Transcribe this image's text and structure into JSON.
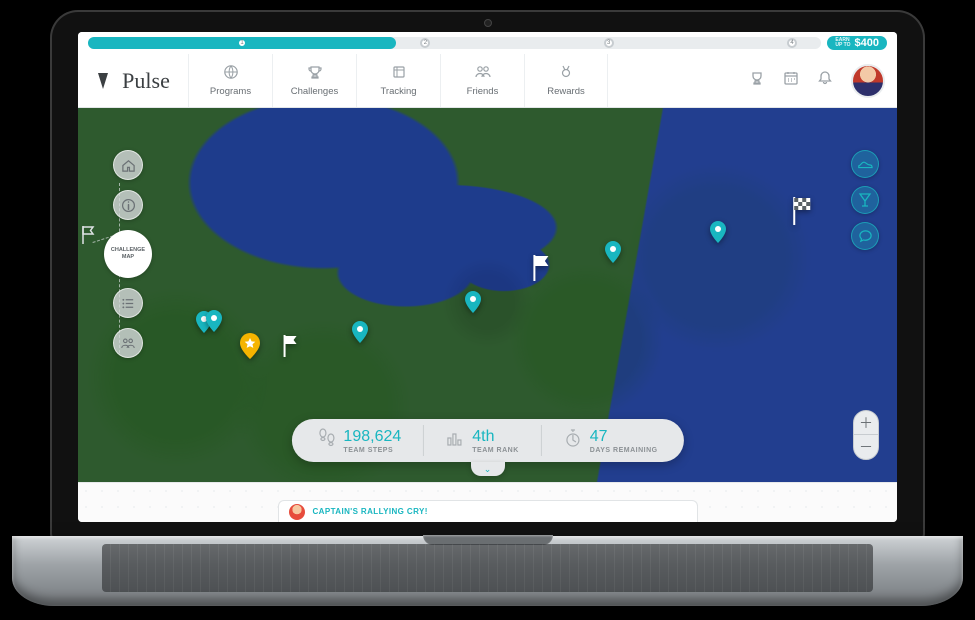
{
  "brand": {
    "name": "Virgin Pulse",
    "script": "Pulse"
  },
  "earn": {
    "prefix_line1": "EARN",
    "prefix_line2": "UP TO",
    "amount": "$400"
  },
  "progress": {
    "percent": 42,
    "steps": [
      1,
      2,
      3,
      4
    ]
  },
  "nav": {
    "programs": "Programs",
    "challenges": "Challenges",
    "tracking": "Tracking",
    "friends": "Friends",
    "rewards": "Rewards"
  },
  "left_tools": {
    "challenge_map_label": "CHALLENGE MAP"
  },
  "stats": {
    "team_steps": {
      "value": "198,624",
      "label": "TEAM STEPS"
    },
    "team_rank": {
      "value": "4th",
      "label": "TEAM RANK"
    },
    "days": {
      "value": "47",
      "label": "DAYS REMAINING"
    }
  },
  "rally": {
    "label": "CAPTAIN'S RALLYING CRY!"
  },
  "icons": {
    "home": "home-icon",
    "info": "info-icon",
    "list": "list-icon",
    "group": "group-icon",
    "shoe": "shoe-icon",
    "martini": "martini-icon",
    "chat": "chat-icon",
    "trophy": "trophy-icon",
    "calendar": "calendar-icon",
    "bell": "bell-icon",
    "globe": "globe-icon",
    "track": "tracking-icon",
    "friends": "friends-icon",
    "medal": "rewards-icon",
    "steps": "footsteps-icon",
    "rank": "bars-icon",
    "clock": "stopwatch-icon",
    "plus": "plus-icon",
    "minus": "minus-icon",
    "chev": "chevron-down-icon"
  }
}
